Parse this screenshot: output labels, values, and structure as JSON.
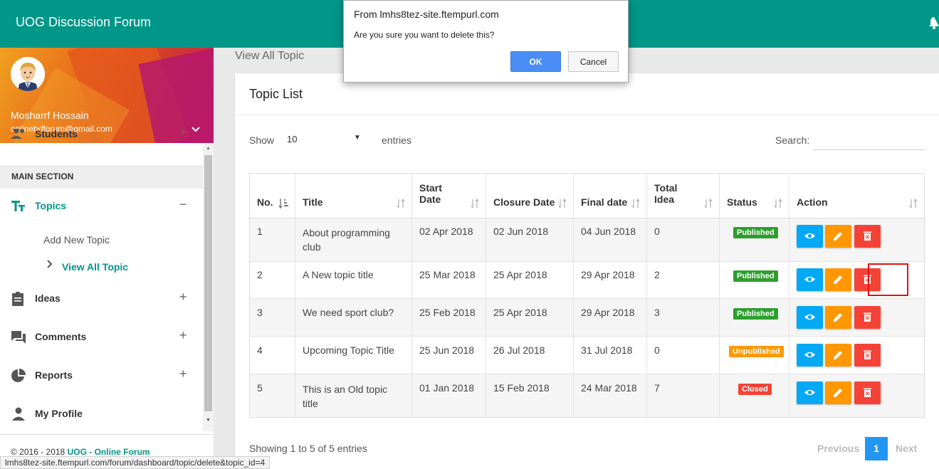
{
  "app": {
    "title": "UOG Discussion Forum"
  },
  "user": {
    "name": "Mosharrf Hossain",
    "email": "onlinebdforum@gmail.com"
  },
  "sidebar": {
    "students_label": "Students",
    "section_label": "MAIN SECTION",
    "topics_label": "Topics",
    "topics_sub": [
      "Add New Topic",
      "View All Topic"
    ],
    "ideas_label": "Ideas",
    "comments_label": "Comments",
    "reports_label": "Reports",
    "profile_label": "My Profile",
    "footer_prefix": "© 2016 - 2018 ",
    "footer_link": "UOG - Online Forum"
  },
  "page": {
    "heading": "View All Topic"
  },
  "card": {
    "title": "Topic List",
    "show_label": "Show",
    "entries_value": "10",
    "entries_label": "entries",
    "search_label": "Search:",
    "search_value": "",
    "showing_text": "Showing 1 to 5 of 5 entries",
    "prev_label": "Previous",
    "page_number": "1",
    "next_label": "Next"
  },
  "table": {
    "headers": {
      "no": "No.",
      "title": "Title",
      "start_1": "Start",
      "start_2": "Date",
      "closure": "Closure Date",
      "final": "Final date",
      "total_1": "Total",
      "total_2": "Idea",
      "status": "Status",
      "action": "Action"
    },
    "rows": [
      {
        "no": "1",
        "title_1": "About programming",
        "title_2": "club",
        "start": "02 Apr 2018",
        "closure": "02 Jun 2018",
        "final": "04 Jun 2018",
        "total": "0",
        "status": "Published"
      },
      {
        "no": "2",
        "title_1": "A New topic title",
        "title_2": "",
        "start": "25 Mar 2018",
        "closure": "25 Apr 2018",
        "final": "29 Apr 2018",
        "total": "2",
        "status": "Published"
      },
      {
        "no": "3",
        "title_1": "We need sport club?",
        "title_2": "",
        "start": "25 Feb 2018",
        "closure": "25 Apr 2018",
        "final": "29 Apr 2018",
        "total": "3",
        "status": "Published"
      },
      {
        "no": "4",
        "title_1": "Upcoming Topic Title",
        "title_2": "",
        "start": "25 Jun 2018",
        "closure": "26 Jul 2018",
        "final": "31 Jul 2018",
        "total": "0",
        "status": "Unpublished"
      },
      {
        "no": "5",
        "title_1": "This is an Old topic",
        "title_2": "title",
        "start": "01 Jan 2018",
        "closure": "15 Feb 2018",
        "final": "24 Mar 2018",
        "total": "7",
        "status": "Closed"
      }
    ]
  },
  "dialog": {
    "from": "From lmhs8tez-site.ftempurl.com",
    "message": "Are you sure you want to delete this?",
    "ok_label": "OK",
    "cancel_label": "Cancel"
  },
  "statusbar": {
    "url": "lmhs8tez-site.ftempurl.com/forum/dashboard/topic/delete&topic_id=4"
  },
  "colors": {
    "primary": "#009688",
    "published": "#2e9e2e",
    "unpublished": "#ff9800",
    "closed": "#f44336",
    "view_button": "#03a9f4",
    "edit_button": "#ff9800",
    "delete_button": "#f44336",
    "page_active": "#2196f3"
  }
}
